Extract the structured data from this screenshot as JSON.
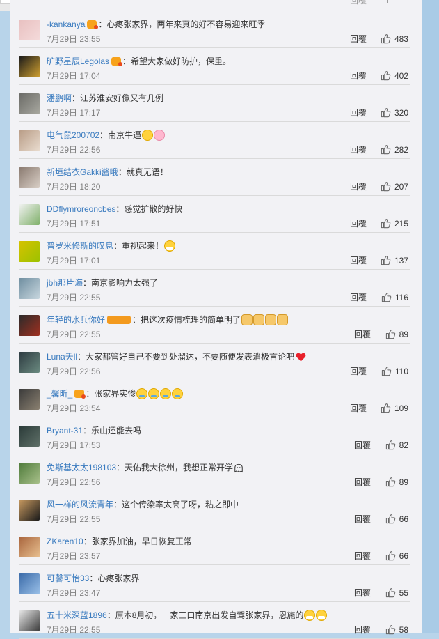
{
  "header": {
    "ghost_reply_label": "回覆",
    "ghost_like_label": "1"
  },
  "actions": {
    "reply_label": "回覆"
  },
  "comments": [
    {
      "user": "-kankanya",
      "badge": "v",
      "text": "：心疼张家界，两年来真的好不容易迎来旺季",
      "emojis": [],
      "date": "7月29日 23:55",
      "likes": "483",
      "avatar": [
        "#e8c0c0",
        "#f4dada"
      ]
    },
    {
      "user": "旷野星辰Legolas",
      "badge": "v",
      "text": "：希望大家做好防护，保重。",
      "emojis": [],
      "date": "7月29日 17:04",
      "likes": "402",
      "avatar": [
        "#1a1a1a",
        "#d0a030"
      ]
    },
    {
      "user": "潘鹏啊",
      "badge": "",
      "text": "：江苏淮安好像又有几例",
      "emojis": [],
      "date": "7月29日 17:17",
      "likes": "320",
      "avatar": [
        "#6a6a66",
        "#a8a8a0"
      ]
    },
    {
      "user": "电气鼠200702",
      "badge": "",
      "text": "：南京牛逼",
      "emojis": [
        "smile",
        "pig"
      ],
      "date": "7月29日 22:56",
      "likes": "282",
      "avatar": [
        "#b89c86",
        "#e9dccf"
      ]
    },
    {
      "user": "新垣结衣Gakki酱哦",
      "badge": "",
      "text": "：就真无语！",
      "emojis": [],
      "date": "7月29日 18:20",
      "likes": "207",
      "avatar": [
        "#8a7a70",
        "#d9cfc6"
      ]
    },
    {
      "user": "DDflymroreoncbes",
      "badge": "",
      "text": "：感觉扩散的好快",
      "emojis": [],
      "date": "7月29日 17:51",
      "likes": "215",
      "avatar": [
        "#f2f2f2",
        "#7fb06a"
      ]
    },
    {
      "user": "普罗米修斯的叹息",
      "badge": "",
      "text": "：重视起来！",
      "emojis": [
        "mask"
      ],
      "date": "7月29日 17:01",
      "likes": "137",
      "avatar": [
        "#d6c200",
        "#9cc200"
      ]
    },
    {
      "user": "jbh那片海",
      "badge": "",
      "text": "：南京影响力太强了",
      "emojis": [],
      "date": "7月29日 22:55",
      "likes": "116",
      "avatar": [
        "#6f8ea0",
        "#c7d6de"
      ]
    },
    {
      "user": "年轻的水兵你好",
      "badge": "wide",
      "text": "：把这次疫情梳理的简单明了",
      "emojis": [
        "thumb",
        "thumb",
        "thumb",
        "thumb"
      ],
      "date": "7月29日 22:55",
      "likes": "89",
      "avatar": [
        "#2a2a2a",
        "#a03020"
      ]
    },
    {
      "user": "Luna夭ll",
      "badge": "",
      "text": "：大家都管好自己不要到处溜达，不要随便发表消极言论吧",
      "emojis": [
        "heart"
      ],
      "date": "7月29日 22:56",
      "likes": "110",
      "avatar": [
        "#2d3a40",
        "#6a8a80"
      ]
    },
    {
      "user": "_馨昕_",
      "badge": "v",
      "text": "：张家界实惨",
      "emojis": [
        "cry",
        "cry",
        "cry",
        "cry"
      ],
      "date": "7月29日 23:54",
      "likes": "109",
      "avatar": [
        "#3a3a3a",
        "#8a8070"
      ]
    },
    {
      "user": "Bryant-31",
      "badge": "",
      "text": "：乐山还能去吗",
      "emojis": [],
      "date": "7月29日 17:53",
      "likes": "82",
      "avatar": [
        "#2a3a38",
        "#5f7068"
      ]
    },
    {
      "user": "免斯基太太198103",
      "badge": "",
      "text": "：天佑我大徐州，我想正常开学",
      "emojis": [
        "ghost"
      ],
      "date": "7月29日 22:56",
      "likes": "89",
      "avatar": [
        "#4e7a3a",
        "#a8c08a"
      ]
    },
    {
      "user": "风一样的风流青年",
      "badge": "",
      "text": "：这个传染率太高了呀，粘之即中",
      "emojis": [],
      "date": "7月29日 22:55",
      "likes": "66",
      "avatar": [
        "#c89a60",
        "#1a1a1a"
      ]
    },
    {
      "user": "ZKaren10",
      "badge": "",
      "text": "：张家界加油，早日恢复正常",
      "emojis": [],
      "date": "7月29日 23:57",
      "likes": "66",
      "avatar": [
        "#a8643c",
        "#e8c090"
      ]
    },
    {
      "user": "可馨可怡33",
      "badge": "",
      "text": "：心疼张家界",
      "emojis": [],
      "date": "7月29日 23:47",
      "likes": "55",
      "avatar": [
        "#3a6aa8",
        "#9ac0e8"
      ]
    },
    {
      "user": "五十米深蓝1896",
      "badge": "",
      "text": "：原本8月初，一家三口南京出发自驾张家界，恩施的",
      "emojis": [
        "mask",
        "mask"
      ],
      "date": "7月29日 22:55",
      "likes": "58",
      "avatar": [
        "#e8e8e8",
        "#3a3a3a"
      ]
    }
  ],
  "colors": {
    "username": "#3a7bbf",
    "badge": "#f7a21b",
    "divider": "#dadada",
    "date": "#808080"
  }
}
